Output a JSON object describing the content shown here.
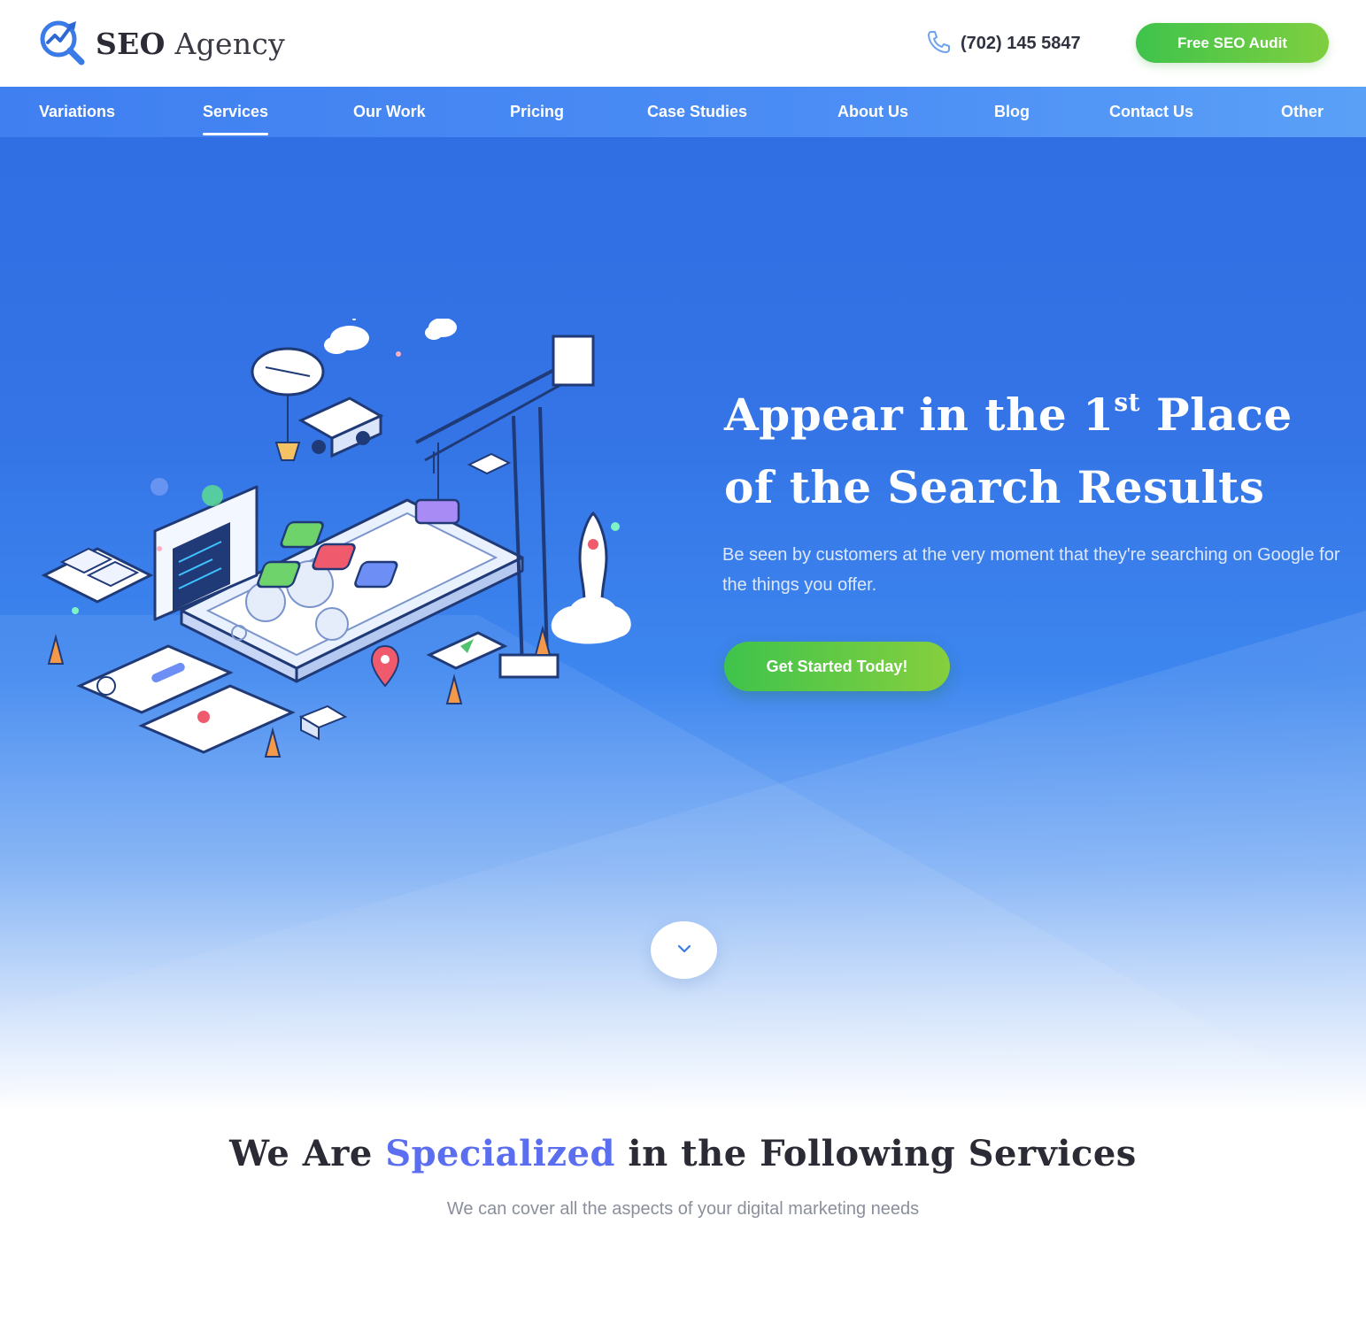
{
  "header": {
    "logo_bold": "SEO",
    "logo_light": "Agency",
    "phone": "(702) 145 5847",
    "audit_button": "Free SEO Audit"
  },
  "nav": {
    "items": [
      {
        "label": "Variations",
        "active": false
      },
      {
        "label": "Services",
        "active": true
      },
      {
        "label": "Our Work",
        "active": false
      },
      {
        "label": "Pricing",
        "active": false
      },
      {
        "label": "Case Studies",
        "active": false
      },
      {
        "label": "About Us",
        "active": false
      },
      {
        "label": "Blog",
        "active": false
      },
      {
        "label": "Contact Us",
        "active": false
      },
      {
        "label": "Other",
        "active": false
      }
    ]
  },
  "hero": {
    "title_part1": "Appear in the 1",
    "title_sup": "st",
    "title_part2": " Place",
    "title_line2": "of the Search Results",
    "subtitle": "Be seen by customers at the very moment that they're searching on Google for the things you offer.",
    "cta": "Get Started Today!"
  },
  "services": {
    "title_before": "We Are ",
    "title_accent": "Specialized",
    "title_after": " in the Following Services",
    "subtitle": "We can cover all the aspects of your digital marketing needs"
  },
  "colors": {
    "brand_blue": "#3f7ff0",
    "accent_green": "#3fc34c",
    "accent_purple": "#5b6ef0"
  },
  "icons": [
    "magnifier-chart-logo-icon",
    "phone-icon",
    "chevron-down-icon"
  ]
}
